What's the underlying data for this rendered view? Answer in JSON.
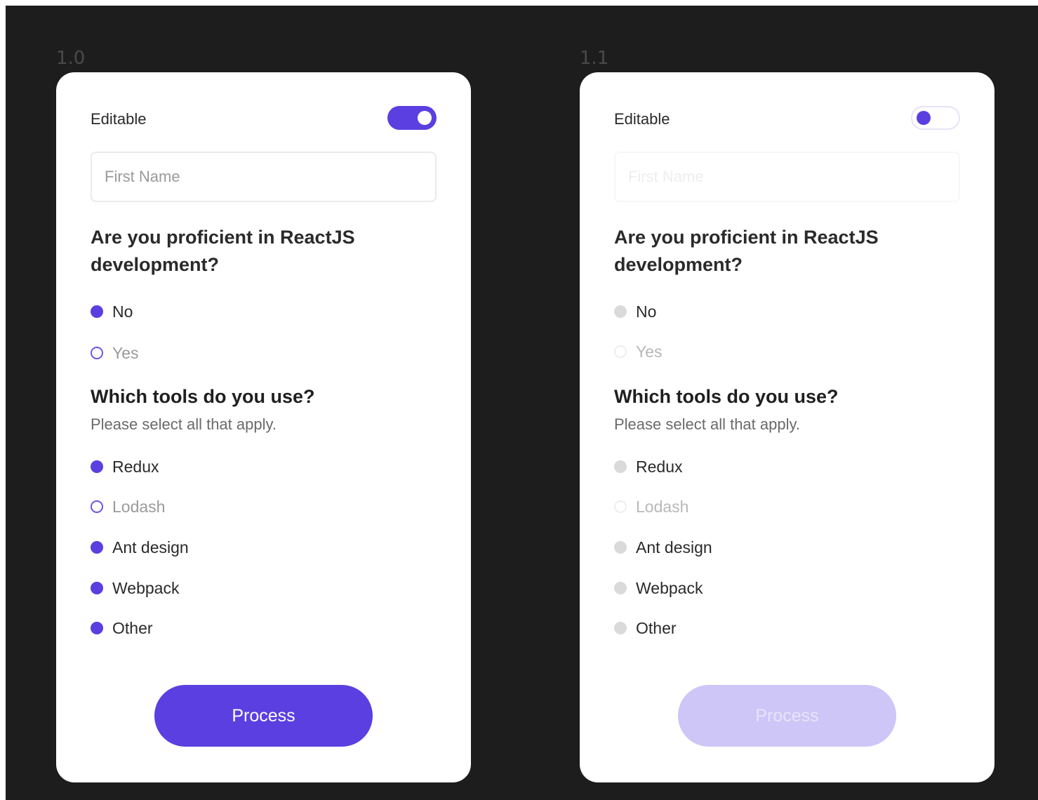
{
  "frames": [
    {
      "label": "1.0",
      "editable_label": "Editable",
      "toggle_state": "on",
      "first_name_placeholder": "First Name",
      "question": "Are you proficient in ReactJS development?",
      "answers": [
        {
          "label": "No",
          "selected": true
        },
        {
          "label": "Yes",
          "selected": false
        }
      ],
      "tools_question": "Which tools do you use?",
      "tools_subtitle": "Please select all that apply.",
      "tools": [
        {
          "label": "Redux",
          "selected": true
        },
        {
          "label": "Lodash",
          "selected": false
        },
        {
          "label": "Ant design",
          "selected": true
        },
        {
          "label": "Webpack",
          "selected": true
        },
        {
          "label": "Other",
          "selected": true
        }
      ],
      "button_label": "Process",
      "enabled": true
    },
    {
      "label": "1.1",
      "editable_label": "Editable",
      "toggle_state": "off",
      "first_name_placeholder": "First Name",
      "question": "Are you proficient in ReactJS development?",
      "answers": [
        {
          "label": "No",
          "selected": true
        },
        {
          "label": "Yes",
          "selected": false
        }
      ],
      "tools_question": "Which tools do you use?",
      "tools_subtitle": "Please select all that apply.",
      "tools": [
        {
          "label": "Redux",
          "selected": true
        },
        {
          "label": "Lodash",
          "selected": false
        },
        {
          "label": "Ant design",
          "selected": true
        },
        {
          "label": "Webpack",
          "selected": true
        },
        {
          "label": "Other",
          "selected": true
        }
      ],
      "button_label": "Process",
      "enabled": false
    }
  ],
  "colors": {
    "background": "#1d1d1d",
    "accent": "#5b3fe0",
    "accent_disabled": "#cdc6f6",
    "card": "#ffffff"
  }
}
